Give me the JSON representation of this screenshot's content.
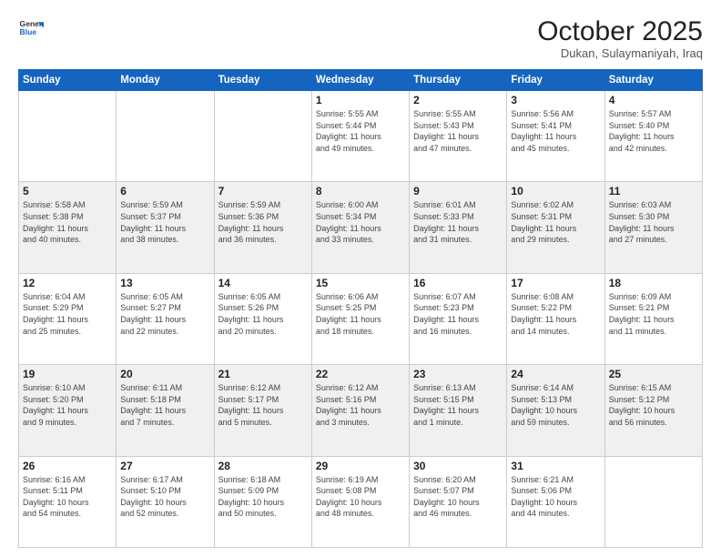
{
  "logo": {
    "line1": "General",
    "line2": "Blue"
  },
  "title": "October 2025",
  "location": "Dukan, Sulaymaniyah, Iraq",
  "days_of_week": [
    "Sunday",
    "Monday",
    "Tuesday",
    "Wednesday",
    "Thursday",
    "Friday",
    "Saturday"
  ],
  "weeks": [
    [
      {
        "day": "",
        "info": ""
      },
      {
        "day": "",
        "info": ""
      },
      {
        "day": "",
        "info": ""
      },
      {
        "day": "1",
        "info": "Sunrise: 5:55 AM\nSunset: 5:44 PM\nDaylight: 11 hours\nand 49 minutes."
      },
      {
        "day": "2",
        "info": "Sunrise: 5:55 AM\nSunset: 5:43 PM\nDaylight: 11 hours\nand 47 minutes."
      },
      {
        "day": "3",
        "info": "Sunrise: 5:56 AM\nSunset: 5:41 PM\nDaylight: 11 hours\nand 45 minutes."
      },
      {
        "day": "4",
        "info": "Sunrise: 5:57 AM\nSunset: 5:40 PM\nDaylight: 11 hours\nand 42 minutes."
      }
    ],
    [
      {
        "day": "5",
        "info": "Sunrise: 5:58 AM\nSunset: 5:38 PM\nDaylight: 11 hours\nand 40 minutes."
      },
      {
        "day": "6",
        "info": "Sunrise: 5:59 AM\nSunset: 5:37 PM\nDaylight: 11 hours\nand 38 minutes."
      },
      {
        "day": "7",
        "info": "Sunrise: 5:59 AM\nSunset: 5:36 PM\nDaylight: 11 hours\nand 36 minutes."
      },
      {
        "day": "8",
        "info": "Sunrise: 6:00 AM\nSunset: 5:34 PM\nDaylight: 11 hours\nand 33 minutes."
      },
      {
        "day": "9",
        "info": "Sunrise: 6:01 AM\nSunset: 5:33 PM\nDaylight: 11 hours\nand 31 minutes."
      },
      {
        "day": "10",
        "info": "Sunrise: 6:02 AM\nSunset: 5:31 PM\nDaylight: 11 hours\nand 29 minutes."
      },
      {
        "day": "11",
        "info": "Sunrise: 6:03 AM\nSunset: 5:30 PM\nDaylight: 11 hours\nand 27 minutes."
      }
    ],
    [
      {
        "day": "12",
        "info": "Sunrise: 6:04 AM\nSunset: 5:29 PM\nDaylight: 11 hours\nand 25 minutes."
      },
      {
        "day": "13",
        "info": "Sunrise: 6:05 AM\nSunset: 5:27 PM\nDaylight: 11 hours\nand 22 minutes."
      },
      {
        "day": "14",
        "info": "Sunrise: 6:05 AM\nSunset: 5:26 PM\nDaylight: 11 hours\nand 20 minutes."
      },
      {
        "day": "15",
        "info": "Sunrise: 6:06 AM\nSunset: 5:25 PM\nDaylight: 11 hours\nand 18 minutes."
      },
      {
        "day": "16",
        "info": "Sunrise: 6:07 AM\nSunset: 5:23 PM\nDaylight: 11 hours\nand 16 minutes."
      },
      {
        "day": "17",
        "info": "Sunrise: 6:08 AM\nSunset: 5:22 PM\nDaylight: 11 hours\nand 14 minutes."
      },
      {
        "day": "18",
        "info": "Sunrise: 6:09 AM\nSunset: 5:21 PM\nDaylight: 11 hours\nand 11 minutes."
      }
    ],
    [
      {
        "day": "19",
        "info": "Sunrise: 6:10 AM\nSunset: 5:20 PM\nDaylight: 11 hours\nand 9 minutes."
      },
      {
        "day": "20",
        "info": "Sunrise: 6:11 AM\nSunset: 5:18 PM\nDaylight: 11 hours\nand 7 minutes."
      },
      {
        "day": "21",
        "info": "Sunrise: 6:12 AM\nSunset: 5:17 PM\nDaylight: 11 hours\nand 5 minutes."
      },
      {
        "day": "22",
        "info": "Sunrise: 6:12 AM\nSunset: 5:16 PM\nDaylight: 11 hours\nand 3 minutes."
      },
      {
        "day": "23",
        "info": "Sunrise: 6:13 AM\nSunset: 5:15 PM\nDaylight: 11 hours\nand 1 minute."
      },
      {
        "day": "24",
        "info": "Sunrise: 6:14 AM\nSunset: 5:13 PM\nDaylight: 10 hours\nand 59 minutes."
      },
      {
        "day": "25",
        "info": "Sunrise: 6:15 AM\nSunset: 5:12 PM\nDaylight: 10 hours\nand 56 minutes."
      }
    ],
    [
      {
        "day": "26",
        "info": "Sunrise: 6:16 AM\nSunset: 5:11 PM\nDaylight: 10 hours\nand 54 minutes."
      },
      {
        "day": "27",
        "info": "Sunrise: 6:17 AM\nSunset: 5:10 PM\nDaylight: 10 hours\nand 52 minutes."
      },
      {
        "day": "28",
        "info": "Sunrise: 6:18 AM\nSunset: 5:09 PM\nDaylight: 10 hours\nand 50 minutes."
      },
      {
        "day": "29",
        "info": "Sunrise: 6:19 AM\nSunset: 5:08 PM\nDaylight: 10 hours\nand 48 minutes."
      },
      {
        "day": "30",
        "info": "Sunrise: 6:20 AM\nSunset: 5:07 PM\nDaylight: 10 hours\nand 46 minutes."
      },
      {
        "day": "31",
        "info": "Sunrise: 6:21 AM\nSunset: 5:06 PM\nDaylight: 10 hours\nand 44 minutes."
      },
      {
        "day": "",
        "info": ""
      }
    ]
  ]
}
